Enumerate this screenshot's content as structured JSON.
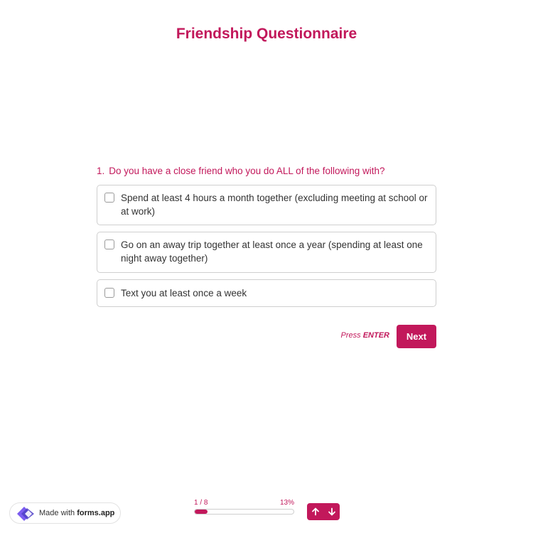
{
  "form": {
    "title": "Friendship Questionnaire",
    "question_number": "1.",
    "question_text": "Do you have a close friend who you do ALL of the following with?",
    "options": [
      {
        "label": "Spend at least 4 hours a month together (excluding meeting at school or at work)",
        "checked": false
      },
      {
        "label": "Go on an away trip together at least once a year (spending at least one night away together)",
        "checked": false
      },
      {
        "label": "Text you at least once a week",
        "checked": false
      }
    ],
    "press_prefix": "Press",
    "press_key": "ENTER",
    "next_label": "Next"
  },
  "footer": {
    "made_with_prefix": "Made with",
    "brand": "forms.app",
    "progress_count": "1 / 8",
    "progress_percent": "13%",
    "progress_value": 13,
    "nav_up_icon": "arrow-up-icon",
    "nav_down_icon": "arrow-down-icon"
  },
  "colors": {
    "accent": "#c2185b",
    "logo_purple": "#7b5cf0"
  }
}
